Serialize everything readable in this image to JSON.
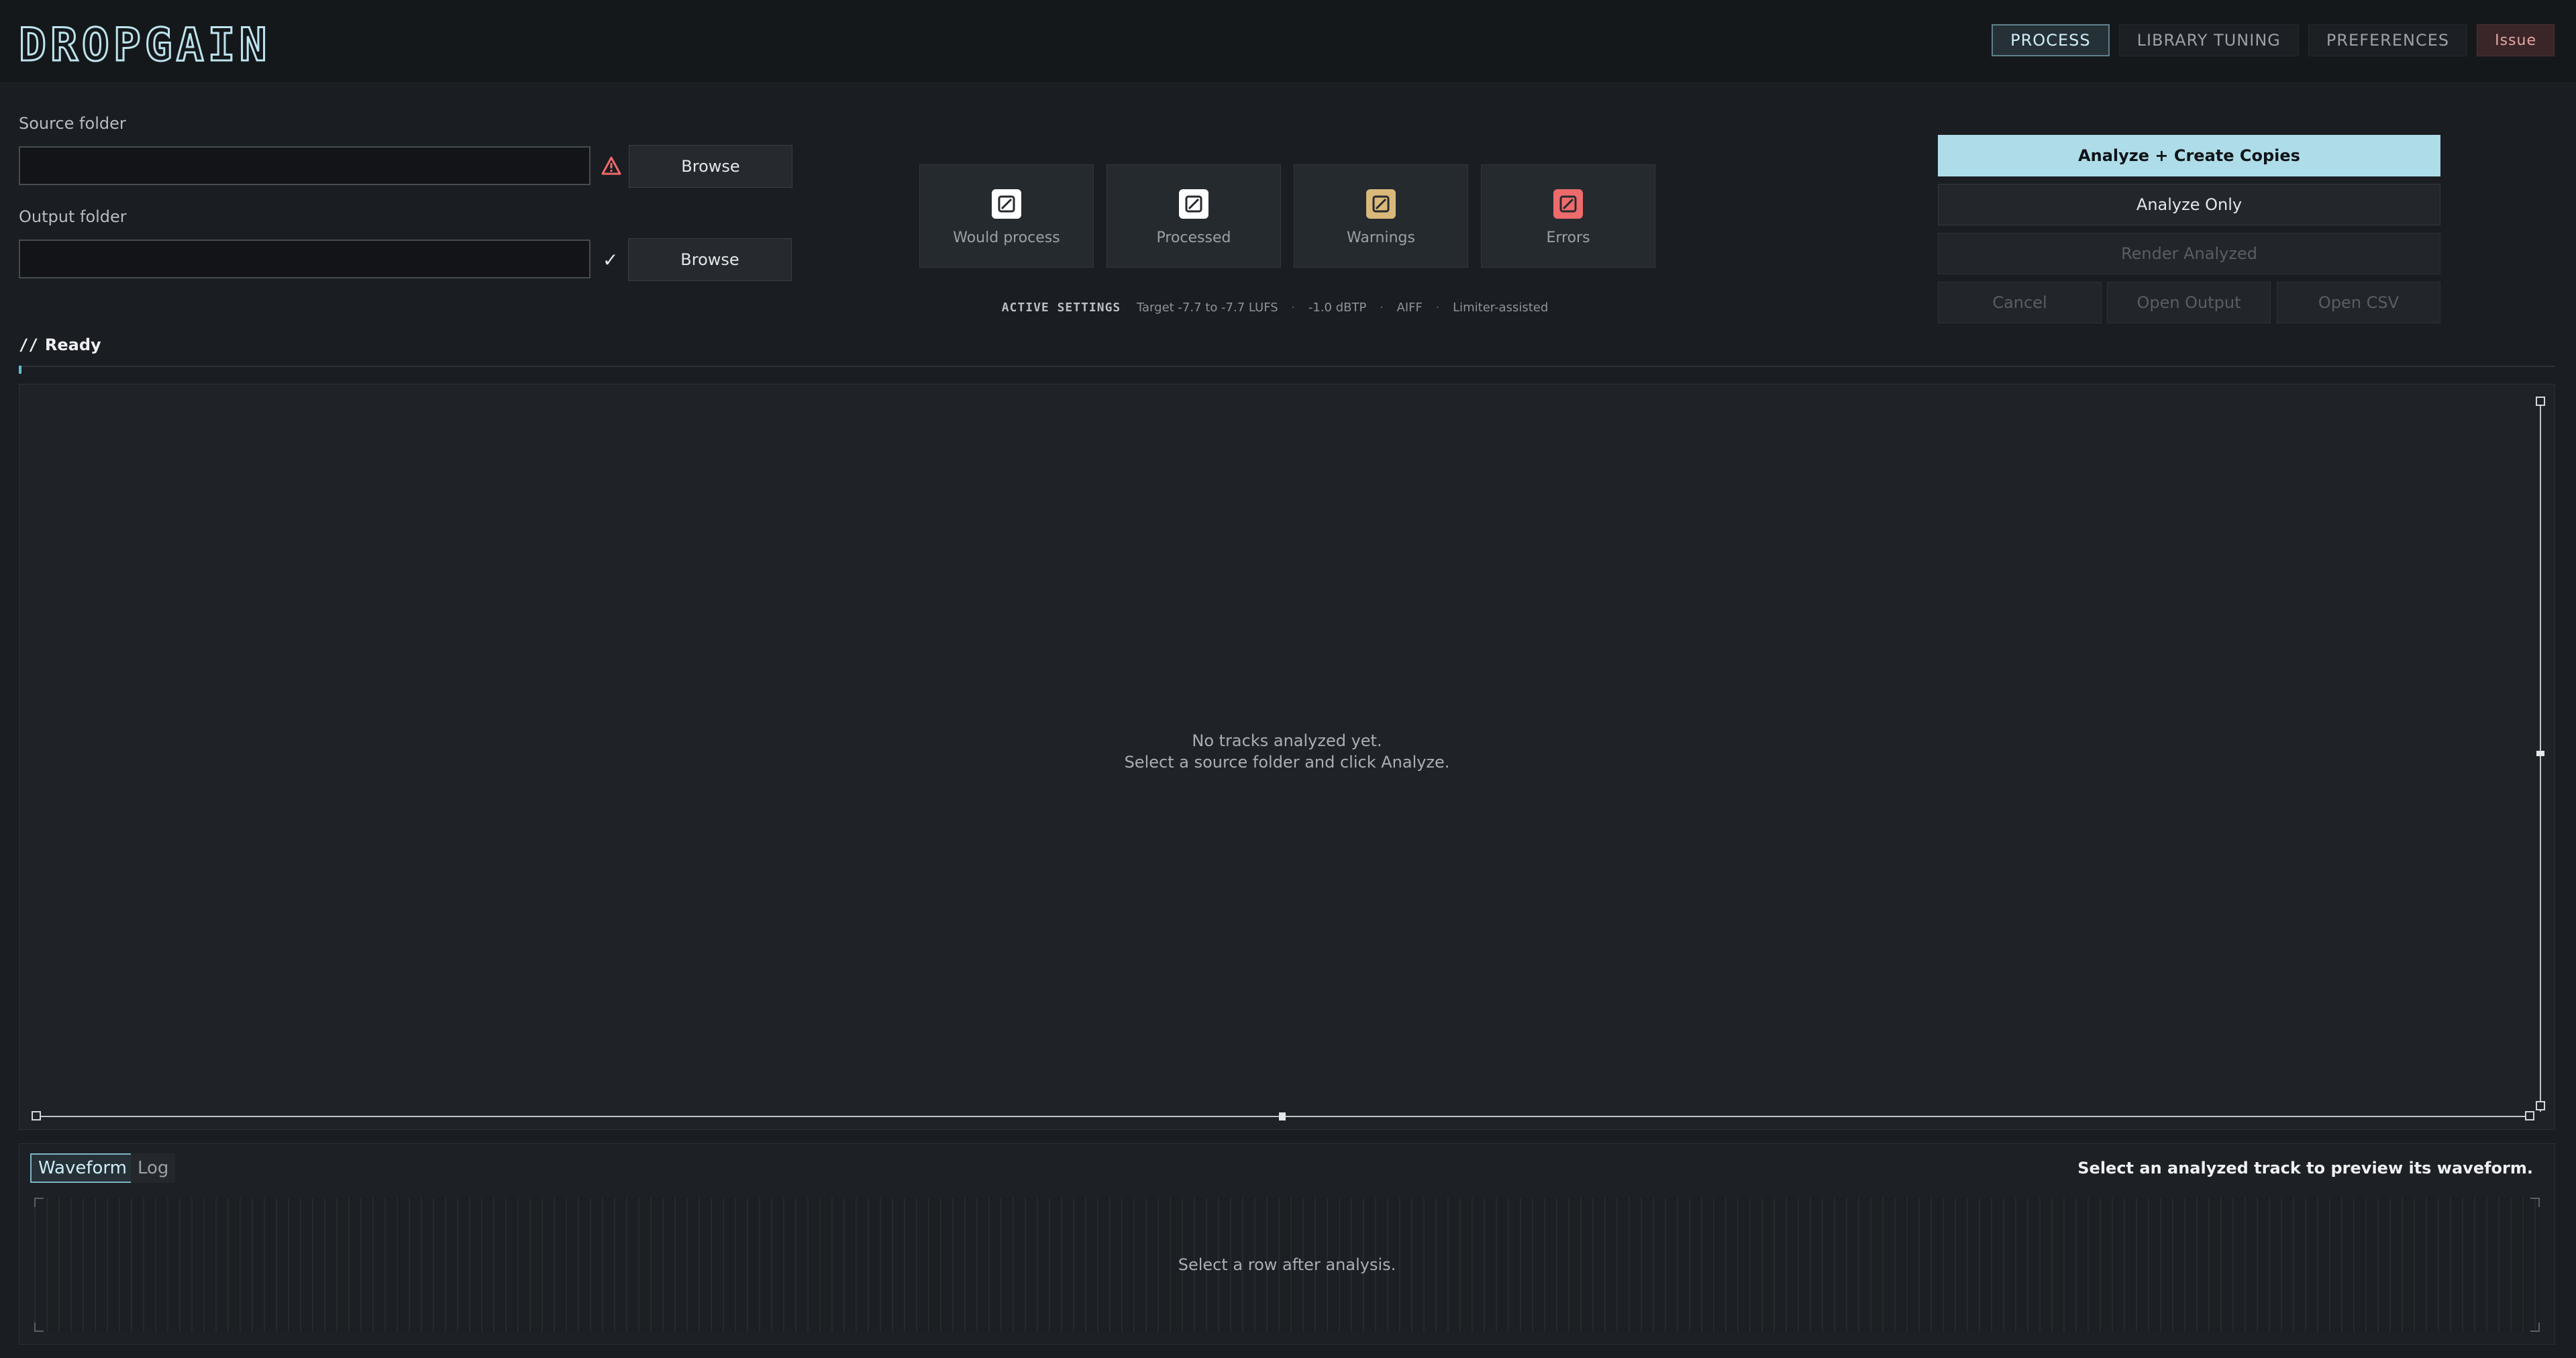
{
  "app": {
    "logo_text": "DROPGAIN"
  },
  "nav": {
    "items": [
      {
        "label": "PROCESS",
        "active": true
      },
      {
        "label": "LIBRARY TUNING",
        "active": false
      },
      {
        "label": "PREFERENCES",
        "active": false
      },
      {
        "label": "Issue",
        "active": false
      }
    ]
  },
  "folders": {
    "source_label": "Source folder",
    "source_value": "",
    "source_status": "warning",
    "output_label": "Output folder",
    "output_value": "",
    "output_status": "ok",
    "browse_label": "Browse"
  },
  "stats": {
    "cards": [
      {
        "label": "Would process",
        "icon": "slash-square-icon",
        "color": "#ffffff"
      },
      {
        "label": "Processed",
        "icon": "slash-square-icon",
        "color": "#ffffff"
      },
      {
        "label": "Warnings",
        "icon": "slash-square-icon",
        "color": "#d9b87a"
      },
      {
        "label": "Errors",
        "icon": "slash-square-icon",
        "color": "#ee6b6b"
      }
    ]
  },
  "active_settings": {
    "title": "ACTIVE SETTINGS",
    "target": "Target -7.7 to -7.7 LUFS",
    "true_peak": "-1.0 dBTP",
    "format": "AIFF",
    "mode": "Limiter-assisted",
    "separator": "·"
  },
  "actions": {
    "analyze_create": "Analyze + Create Copies",
    "analyze_only": "Analyze Only",
    "render_analyzed": "Render Analyzed",
    "cancel": "Cancel",
    "open_output": "Open Output",
    "open_csv": "Open CSV"
  },
  "status": {
    "marker": "//",
    "text": "Ready",
    "progress": 0
  },
  "table": {
    "empty_line1": "No tracks analyzed yet.",
    "empty_line2": "Select a source folder and click Analyze."
  },
  "bottom": {
    "tabs": [
      {
        "label": "Waveform",
        "active": true
      },
      {
        "label": "Log",
        "active": false
      }
    ],
    "hint": "Select an analyzed track to preview its waveform.",
    "empty_msg": "Select a row after analysis."
  },
  "colors": {
    "accent": "#aedde9",
    "warning": "#d9b87a",
    "error": "#ee6b6b",
    "background": "#1a1d21"
  }
}
